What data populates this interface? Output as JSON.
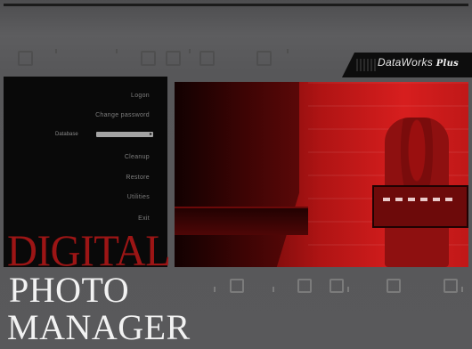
{
  "brand": {
    "name": "DataWorks",
    "suffix": "Plus"
  },
  "menu": {
    "items": [
      "Logon",
      "Change password",
      "Cleanup",
      "Restore",
      "Utilities",
      "Exit"
    ]
  },
  "database": {
    "label": "Database",
    "value": ""
  },
  "title": {
    "line1": "DIGITAL",
    "line2": "PHOTO",
    "line3": "MANAGER"
  },
  "colors": {
    "accent": "#9c1515",
    "panel": "#090909",
    "background": "#58585a"
  }
}
